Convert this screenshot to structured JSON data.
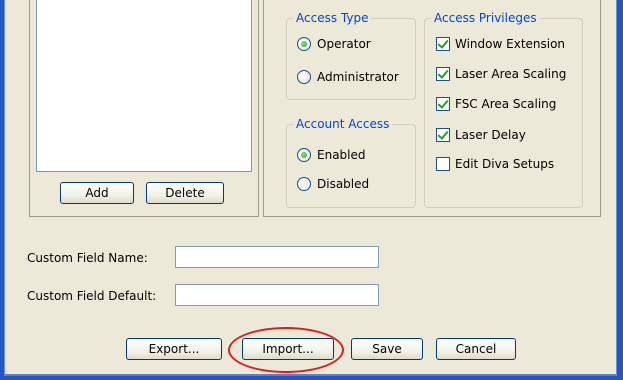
{
  "list_panel": {
    "add_label": "Add",
    "delete_label": "Delete"
  },
  "access_type": {
    "title": "Access Type",
    "options": [
      {
        "label": "Operator",
        "selected": true
      },
      {
        "label": "Administrator",
        "selected": false
      }
    ]
  },
  "account_access": {
    "title": "Account Access",
    "options": [
      {
        "label": "Enabled",
        "selected": true
      },
      {
        "label": "Disabled",
        "selected": false
      }
    ]
  },
  "access_privileges": {
    "title": "Access Privileges",
    "items": [
      {
        "label": "Window Extension",
        "checked": true
      },
      {
        "label": "Laser Area Scaling",
        "checked": true
      },
      {
        "label": "FSC Area Scaling",
        "checked": true
      },
      {
        "label": "Laser Delay",
        "checked": true
      },
      {
        "label": "Edit Diva Setups",
        "checked": false
      }
    ]
  },
  "custom_fields": {
    "name_label": "Custom Field Name:",
    "name_value": "",
    "default_label": "Custom Field Default:",
    "default_value": ""
  },
  "footer": {
    "export_label": "Export...",
    "import_label": "Import...",
    "save_label": "Save",
    "cancel_label": "Cancel"
  },
  "colors": {
    "group_title": "#0046d5",
    "highlight": "#e01b1b",
    "window_frame": "#2356c6"
  }
}
